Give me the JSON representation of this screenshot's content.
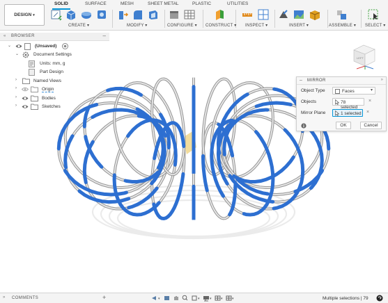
{
  "workspace": {
    "label": "DESIGN"
  },
  "tabs": [
    "SOLID",
    "SURFACE",
    "MESH",
    "SHEET METAL",
    "PLASTIC",
    "UTILITIES"
  ],
  "tool_groups": {
    "create": "CREATE",
    "modify": "MODIFY",
    "configure": "CONFIGURE",
    "construct": "CONSTRUCT",
    "inspect": "INSPECT",
    "insert": "INSERT",
    "assemble": "ASSEMBLE",
    "select": "SELECT"
  },
  "browser": {
    "title": "BROWSER",
    "root": "(Unsaved)",
    "items": [
      "Document Settings",
      "Units: mm, g",
      "Part Design",
      "Named Views",
      "Origin",
      "Bodies",
      "Sketches"
    ]
  },
  "viewcube": {
    "label": "LEFT"
  },
  "mirror": {
    "title": "MIRROR",
    "object_type_label": "Object Type",
    "object_type_value": "Faces",
    "objects_label": "Objects",
    "objects_value": "78 selected",
    "plane_label": "Mirror Plane",
    "plane_value": "1 selected",
    "ok": "OK",
    "cancel": "Cancel"
  },
  "bottom": {
    "comments": "COMMENTS",
    "status": "Multiple selections | 79"
  },
  "colors": {
    "accent": "#0696d7",
    "selected_blue": "#2d6fd1",
    "wire_gray": "#9a9a9a",
    "plane_yellow": "#f1d891"
  }
}
